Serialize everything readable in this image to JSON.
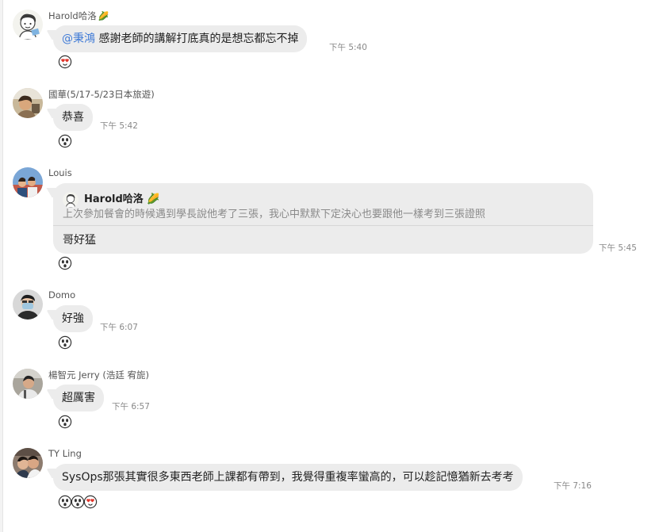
{
  "messages": [
    {
      "sender": "Harold哈洛",
      "sender_emoji": "🌽",
      "mention": "@秉鴻",
      "text": " 感謝老師的講解打底真的是想忘都忘不掉",
      "time": "下午 5:40",
      "reactions": [
        "heart-face-sticker"
      ]
    },
    {
      "sender": "國華(5/17-5/23日本旅遊)",
      "text": "恭喜",
      "time": "下午 5:42",
      "reactions": [
        "surprised-face-sticker"
      ]
    },
    {
      "sender": "Louis",
      "reply": {
        "quoted_sender": "Harold哈洛",
        "quoted_sender_emoji": "🌽",
        "quoted_text": "上次參加餐會的時候遇到學長說他考了三張，我心中默默下定決心也要跟他一樣考到三張證照"
      },
      "text": "哥好猛",
      "time": "下午 5:45",
      "reactions": [
        "surprised-face-sticker"
      ]
    },
    {
      "sender": "Domo",
      "text": "好強",
      "time": "下午 6:07",
      "reactions": [
        "surprised-face-sticker"
      ]
    },
    {
      "sender": "楊智元 Jerry (浩廷 宥旎)",
      "text": "超厲害",
      "time": "下午 6:57",
      "reactions": [
        "surprised-face-sticker"
      ]
    },
    {
      "sender": "TY Ling",
      "text": "SysOps那張其實很多東西老師上課都有帶到，我覺得重複率蠻高的，可以趁記憶猶新去考考",
      "time": "下午 7:16",
      "reactions": [
        "surprised-face-sticker",
        "surprised-face-sticker",
        "heart-face-sticker"
      ]
    }
  ],
  "colors": {
    "bubble": "#ececec",
    "mention": "#3f7ad6",
    "time": "#888888",
    "quote_text": "#8a8a8a"
  }
}
